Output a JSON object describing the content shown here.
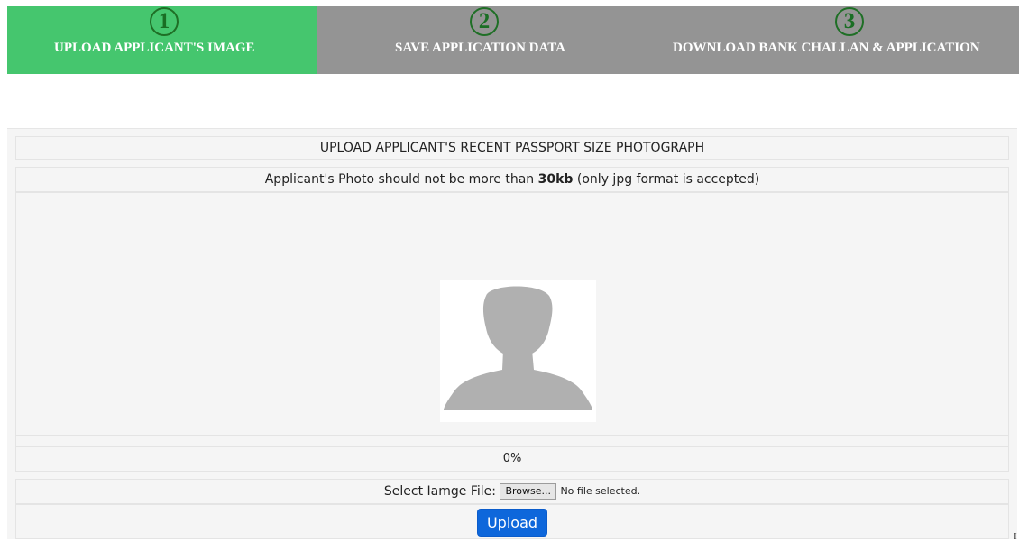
{
  "wizard": {
    "steps": [
      {
        "number": "1",
        "label": "UPLOAD APPLICANT'S IMAGE"
      },
      {
        "number": "2",
        "label": "SAVE APPLICATION DATA"
      },
      {
        "number": "3",
        "label": "DOWNLOAD BANK CHALLAN & APPLICATION"
      }
    ],
    "active_step": 1
  },
  "upload": {
    "heading": "UPLOAD APPLICANT'S RECENT PASSPORT SIZE PHOTOGRAPH",
    "note_prefix": "Applicant's Photo should not be more than ",
    "note_limit": "30kb",
    "note_suffix": " (only jpg format is accepted)",
    "progress_text": "0%",
    "file_label": "Select Iamge File:",
    "browse_label": "Browse...",
    "file_status": "No file selected.",
    "upload_label": "Upload"
  },
  "stray_char": "I",
  "colors": {
    "active_step": "#45c66e",
    "inactive_step": "#949494",
    "upload_button": "#0e67db"
  }
}
